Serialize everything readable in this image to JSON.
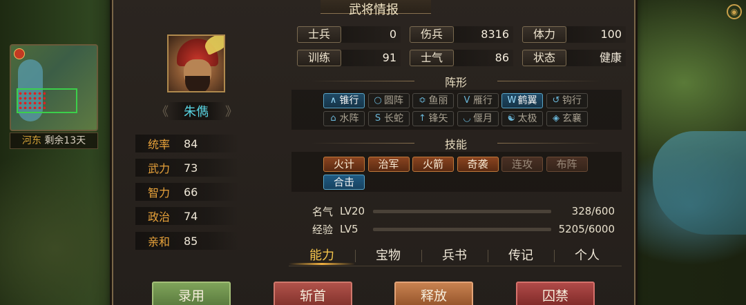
{
  "panel": {
    "title": "武将情报"
  },
  "minimap": {
    "region": "河东",
    "remaining": "剩余13天"
  },
  "general": {
    "name": "朱儁",
    "prev_arrow": "《",
    "next_arrow": "》"
  },
  "attributes": [
    {
      "label": "统率",
      "value": "84"
    },
    {
      "label": "武力",
      "value": "73"
    },
    {
      "label": "智力",
      "value": "66"
    },
    {
      "label": "政治",
      "value": "74"
    },
    {
      "label": "亲和",
      "value": "85"
    }
  ],
  "stats": [
    {
      "label": "士兵",
      "value": "0"
    },
    {
      "label": "伤兵",
      "value": "8316"
    },
    {
      "label": "体力",
      "value": "100"
    },
    {
      "label": "训练",
      "value": "91"
    },
    {
      "label": "士气",
      "value": "86"
    },
    {
      "label": "状态",
      "value": "健康"
    }
  ],
  "formation": {
    "title": "阵形",
    "items": [
      {
        "label": "锥行",
        "icon": "∧",
        "active": true
      },
      {
        "label": "圆阵",
        "icon": "○",
        "active": false
      },
      {
        "label": "鱼丽",
        "icon": "≎",
        "active": false
      },
      {
        "label": "雁行",
        "icon": "V",
        "active": false
      },
      {
        "label": "鹤翼",
        "icon": "W",
        "active": true
      },
      {
        "label": "钩行",
        "icon": "↺",
        "active": false
      },
      {
        "label": "水阵",
        "icon": "⌂",
        "active": false
      },
      {
        "label": "长蛇",
        "icon": "S",
        "active": false
      },
      {
        "label": "锋矢",
        "icon": "↑",
        "active": false
      },
      {
        "label": "偃月",
        "icon": "◡",
        "active": false
      },
      {
        "label": "太极",
        "icon": "☯",
        "active": false
      },
      {
        "label": "玄襄",
        "icon": "◈",
        "active": false
      }
    ]
  },
  "skills": {
    "title": "技能",
    "items": [
      {
        "label": "火计",
        "style": "lit"
      },
      {
        "label": "治军",
        "style": "lit"
      },
      {
        "label": "火箭",
        "style": "lit"
      },
      {
        "label": "奇袭",
        "style": "lit"
      },
      {
        "label": "连攻",
        "style": "dim"
      },
      {
        "label": "布阵",
        "style": "dim"
      },
      {
        "label": "合击",
        "style": "blue"
      }
    ]
  },
  "progress": [
    {
      "label": "名气",
      "level": "LV20",
      "value": "328/600",
      "fraction": 0.547,
      "color": "#d8895a"
    },
    {
      "label": "经验",
      "level": "LV5",
      "value": "5205/6000",
      "fraction": 0.8675,
      "color": "#5aa83a"
    }
  ],
  "tabs": [
    {
      "label": "能力",
      "active": true
    },
    {
      "label": "宝物",
      "active": false
    },
    {
      "label": "兵书",
      "active": false
    },
    {
      "label": "传记",
      "active": false
    },
    {
      "label": "个人",
      "active": false
    }
  ],
  "actions": {
    "hire": "录用",
    "behead": "斩首",
    "release": "释放",
    "imprison": "囚禁"
  }
}
